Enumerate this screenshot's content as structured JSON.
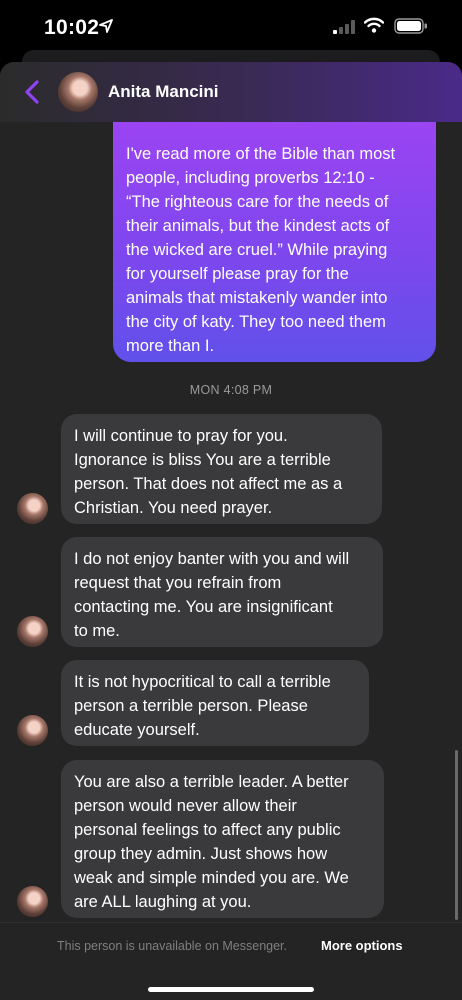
{
  "status_bar": {
    "time": "10:02",
    "icons": [
      "location-arrow-icon",
      "signal-icon",
      "wifi-icon",
      "battery-icon"
    ]
  },
  "header": {
    "contact_name": "Anita Mancini",
    "back_icon": "chevron-left-icon",
    "accent_color": "#8e44f0"
  },
  "messages": {
    "outgoing": "I've read more of the Bible than most\npeople, including proverbs 12:10 -\n“The righteous care for the needs of\ntheir animals, but the kindest acts of\nthe wicked are cruel.”  While praying\nfor yourself please pray for the\nanimals that mistakenly wander into\nthe city of katy. They too need them\nmore than I.",
    "timestamp": "MON 4:08 PM",
    "incoming": [
      "I will continue to pray for you.\nIgnorance is bliss You are a terrible\nperson.  That does not affect me as a\nChristian. You need prayer.",
      "I do not enjoy banter with you and will\nrequest that you refrain from\ncontacting me. You are insignificant\nto me.",
      "It is not hypocritical to call a terrible\nperson a terrible person.  Please\neducate yourself.",
      "You are also a terrible leader. A better\nperson would never allow their\npersonal feelings to affect any public\ngroup they admin. Just shows how\nweak and simple minded you are.  We\nare ALL laughing at you."
    ]
  },
  "footer": {
    "unavailable_text": "This person is unavailable on Messenger.",
    "more_options_label": "More options"
  },
  "colors": {
    "outgoing_bubble": "#8547ef",
    "incoming_bubble": "#3a3a3c",
    "background": "#242424"
  }
}
